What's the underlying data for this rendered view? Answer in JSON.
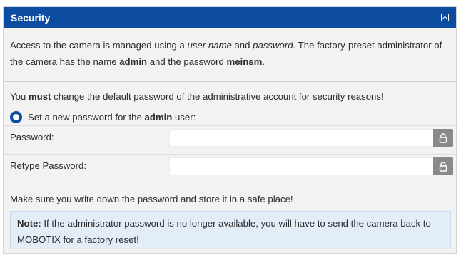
{
  "header": {
    "title": "Security",
    "collapse_icon": "collapse-up-icon"
  },
  "intro": {
    "p1_a": "Access to the camera is managed using a ",
    "p1_b": "user name",
    "p1_c": " and ",
    "p1_d": "password",
    "p1_e": ". The factory-preset administrator of the camera has the name ",
    "p1_f": "admin",
    "p1_g": " and the password ",
    "p1_h": "meinsm",
    "p1_i": "."
  },
  "warning": {
    "a": "You ",
    "b": "must",
    "c": " change the default password of the administrative account for security reasons!"
  },
  "radio": {
    "label_a": "Set a new password for the ",
    "label_b": "admin",
    "label_c": " user:",
    "selected": true
  },
  "fields": [
    {
      "label": "Password:",
      "value": "",
      "icon": "lock-icon"
    },
    {
      "label": "Retype Password:",
      "value": "",
      "icon": "lock-icon"
    }
  ],
  "store_note": "Make sure you write down the password and store it in a safe place!",
  "note": {
    "label": "Note:",
    "text": " If the administrator password is no longer available, you will have to send the camera back to MOBOTIX for a factory reset!"
  },
  "colors": {
    "header": "#0c4da2",
    "panel": "#f2f2f2",
    "note_bg": "#e3edf8",
    "lock_btn": "#8a8a8a"
  }
}
